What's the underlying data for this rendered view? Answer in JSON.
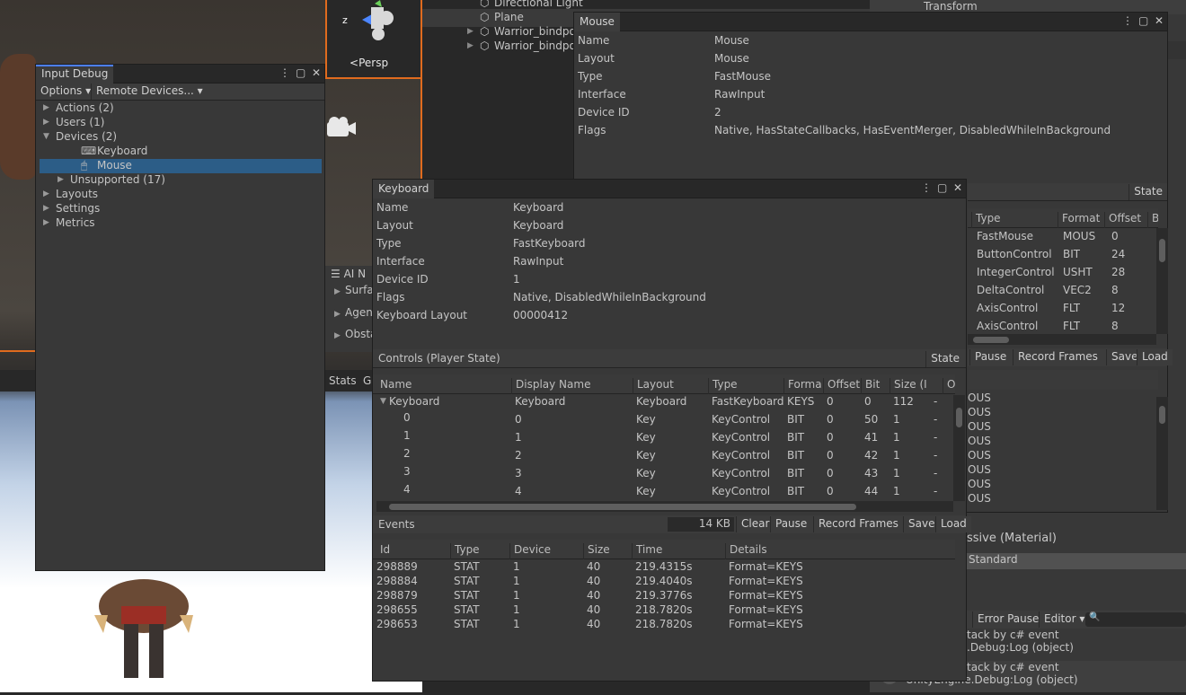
{
  "scene": {
    "view_label": "Persp",
    "axis_label": "z"
  },
  "hierarchy": {
    "items": [
      {
        "label": "Directional Light"
      },
      {
        "label": "Plane"
      },
      {
        "label": "Warrior_bindpos"
      },
      {
        "label": "Warrior_bindpos"
      }
    ]
  },
  "ai_nav": {
    "title": "AI N",
    "items": [
      "Surfa",
      "Agen",
      "Obsta"
    ]
  },
  "stats_tab": "Stats",
  "stats_tab2": "G",
  "input_debug": {
    "title": "Input Debug",
    "toolbar": {
      "options": "Options",
      "remote": "Remote Devices..."
    },
    "tree": [
      {
        "label": "Actions (2)",
        "open": false,
        "indent": 0
      },
      {
        "label": "Users (1)",
        "open": false,
        "indent": 0
      },
      {
        "label": "Devices (2)",
        "open": true,
        "indent": 0
      },
      {
        "label": "Keyboard",
        "icon": "keyboard-icon",
        "indent": 1
      },
      {
        "label": "Mouse",
        "icon": "mouse-icon",
        "indent": 1,
        "selected": true
      },
      {
        "label": "Unsupported (17)",
        "open": false,
        "indent": 1
      },
      {
        "label": "Layouts",
        "open": false,
        "indent": 0
      },
      {
        "label": "Settings",
        "open": false,
        "indent": 0
      },
      {
        "label": "Metrics",
        "open": false,
        "indent": 0
      }
    ]
  },
  "mouse_window": {
    "title": "Mouse",
    "props": [
      {
        "k": "Name",
        "v": "Mouse"
      },
      {
        "k": "Layout",
        "v": "Mouse"
      },
      {
        "k": "Type",
        "v": "FastMouse"
      },
      {
        "k": "Interface",
        "v": "RawInput"
      },
      {
        "k": "Device ID",
        "v": "2"
      },
      {
        "k": "Flags",
        "v": "Native, HasStateCallbacks, HasEventMerger, DisabledWhileInBackground"
      }
    ],
    "state_btn": "State",
    "controls_header": [
      "Type",
      "Format",
      "Offset",
      "Bi"
    ],
    "controls": [
      [
        "FastMouse",
        "MOUS",
        "0"
      ],
      [
        "ButtonControl",
        "BIT",
        "24"
      ],
      [
        "IntegerControl",
        "USHT",
        "28"
      ],
      [
        "DeltaControl",
        "VEC2",
        "8"
      ],
      [
        "AxisControl",
        "FLT",
        "12"
      ],
      [
        "AxisControl",
        "FLT",
        "8"
      ]
    ],
    "event_buttons": [
      "Pause",
      "Record Frames",
      "Save",
      "Load"
    ],
    "events": [
      "OUS",
      "OUS",
      "OUS",
      "OUS",
      "OUS",
      "OUS",
      "OUS",
      "OUS"
    ]
  },
  "keyboard_window": {
    "title": "Keyboard",
    "props": [
      {
        "k": "Name",
        "v": "Keyboard"
      },
      {
        "k": "Layout",
        "v": "Keyboard"
      },
      {
        "k": "Type",
        "v": "FastKeyboard"
      },
      {
        "k": "Interface",
        "v": "RawInput"
      },
      {
        "k": "Device ID",
        "v": "1"
      },
      {
        "k": "Flags",
        "v": "Native, DisabledWhileInBackground"
      },
      {
        "k": "Keyboard Layout",
        "v": "00000412"
      }
    ],
    "controls_title": "Controls (Player State)",
    "state_btn": "State",
    "controls_header": [
      "Name",
      "Display Name",
      "Layout",
      "Type",
      "Forma",
      "Offset",
      "Bit",
      "Size (I",
      "Optim"
    ],
    "controls": [
      {
        "name": "Keyboard",
        "display": "Keyboard",
        "layout": "Keyboard",
        "type": "FastKeyboard",
        "format": "KEYS",
        "offset": "0",
        "bit": "0",
        "size": "112",
        "optim": "-",
        "root": true
      },
      {
        "name": "0",
        "display": "0",
        "layout": "Key",
        "type": "KeyControl",
        "format": "BIT",
        "offset": "0",
        "bit": "50",
        "size": "1",
        "optim": "-"
      },
      {
        "name": "1",
        "display": "1",
        "layout": "Key",
        "type": "KeyControl",
        "format": "BIT",
        "offset": "0",
        "bit": "41",
        "size": "1",
        "optim": "-"
      },
      {
        "name": "2",
        "display": "2",
        "layout": "Key",
        "type": "KeyControl",
        "format": "BIT",
        "offset": "0",
        "bit": "42",
        "size": "1",
        "optim": "-"
      },
      {
        "name": "3",
        "display": "3",
        "layout": "Key",
        "type": "KeyControl",
        "format": "BIT",
        "offset": "0",
        "bit": "43",
        "size": "1",
        "optim": "-"
      },
      {
        "name": "4",
        "display": "4",
        "layout": "Key",
        "type": "KeyControl",
        "format": "BIT",
        "offset": "0",
        "bit": "44",
        "size": "1",
        "optim": "-"
      }
    ],
    "events_title": "Events",
    "events_size": "14 KB",
    "event_buttons": [
      "Clear",
      "Pause",
      "Record Frames",
      "Save",
      "Load"
    ],
    "events_header": [
      "Id",
      "Type",
      "Device",
      "Size",
      "Time",
      "Details"
    ],
    "events": [
      [
        "298889",
        "STAT",
        "1",
        "40",
        "219.4315s",
        "Format=KEYS"
      ],
      [
        "298884",
        "STAT",
        "1",
        "40",
        "219.4040s",
        "Format=KEYS"
      ],
      [
        "298879",
        "STAT",
        "1",
        "40",
        "219.3776s",
        "Format=KEYS"
      ],
      [
        "298655",
        "STAT",
        "1",
        "40",
        "218.7820s",
        "Format=KEYS"
      ],
      [
        "298653",
        "STAT",
        "1",
        "40",
        "218.7820s",
        "Format=KEYS"
      ]
    ]
  },
  "inspector": {
    "component": "Transform",
    "material": "ssive (Material)",
    "shader": "Standard"
  },
  "console": {
    "error_pause": "Error Pause",
    "editor": "Editor",
    "logs": [
      {
        "line1": "tack by c# event",
        "line2": ".Debug:Log (object)"
      },
      {
        "line1": "tack by c# event",
        "line2": "UnityEngine.Debug:Log (object)"
      }
    ]
  }
}
